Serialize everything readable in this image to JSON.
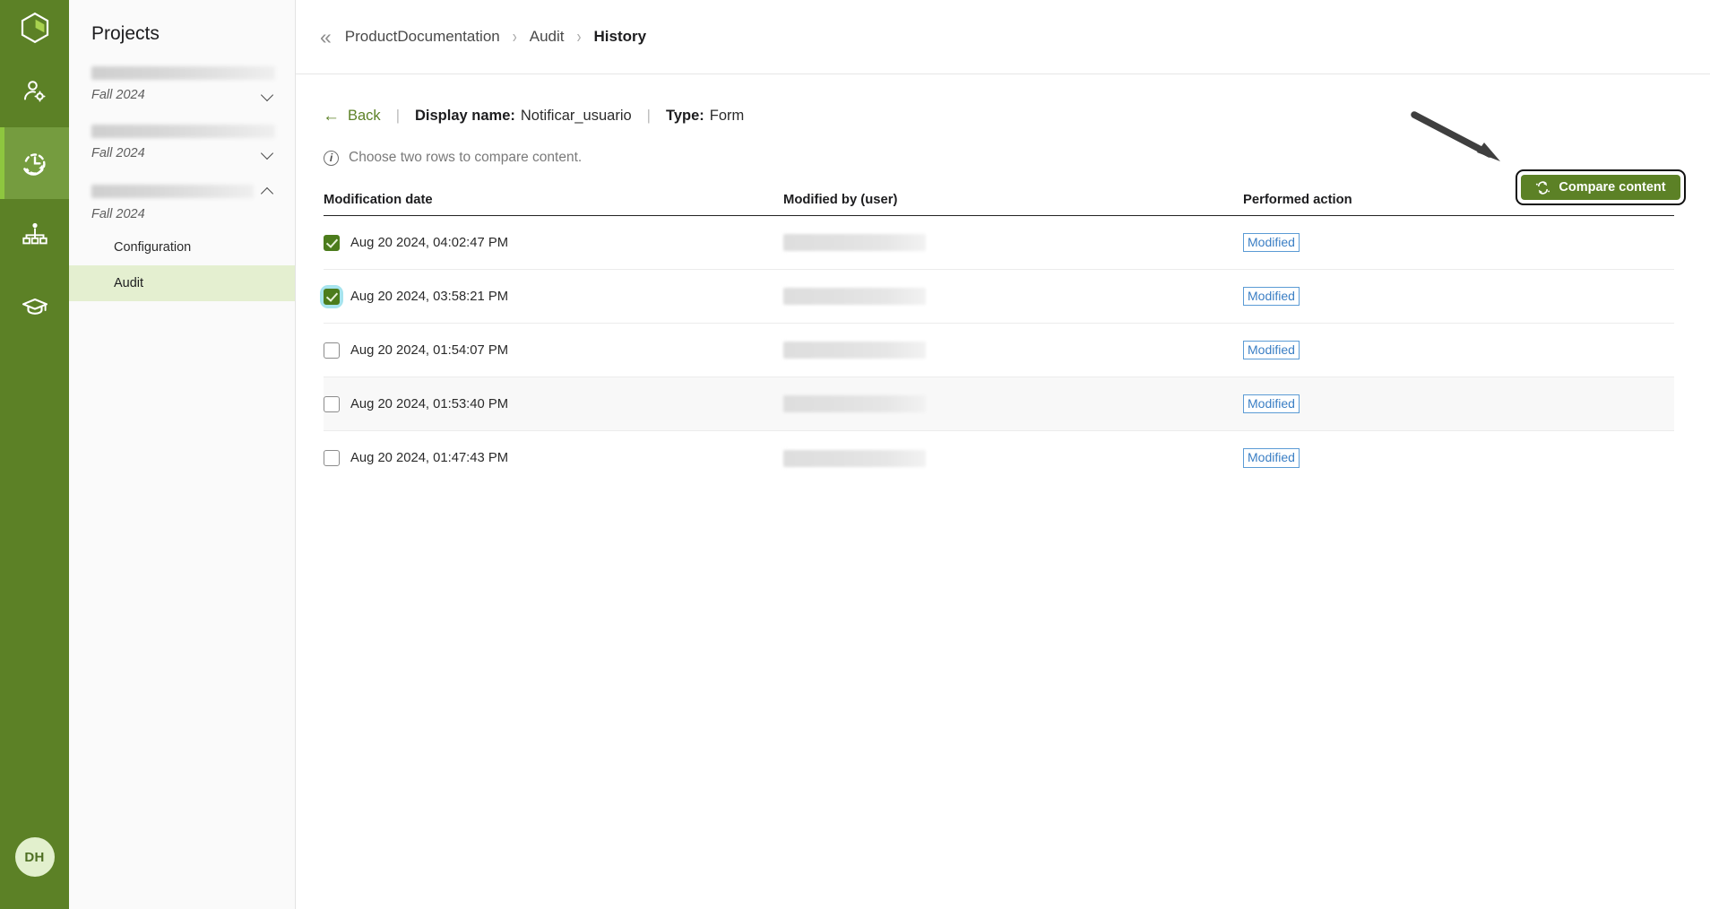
{
  "rail": {
    "logo_icon": "hexagon-logo-icon",
    "items": [
      {
        "name": "user-settings-icon",
        "active": false
      },
      {
        "name": "history-clock-icon",
        "active": true
      },
      {
        "name": "org-chart-icon",
        "active": false
      },
      {
        "name": "graduation-cap-icon",
        "active": false
      }
    ],
    "avatar_initials": "DH",
    "active_color": "#759c3f",
    "brand_color": "#5c8126"
  },
  "panel": {
    "title": "Projects",
    "groups": [
      {
        "season": "Fall 2024",
        "expanded": false
      },
      {
        "season": "Fall 2024",
        "expanded": false
      },
      {
        "season": "Fall 2024",
        "expanded": true
      }
    ],
    "sub_items": [
      {
        "label": "Configuration",
        "active": false
      },
      {
        "label": "Audit",
        "active": true
      }
    ],
    "active_bg": "#e4efd0"
  },
  "breadcrumb": {
    "collapse_icon": "«",
    "separator": "›",
    "items": [
      {
        "label": "ProductDocumentation",
        "current": false
      },
      {
        "label": "Audit",
        "current": false
      },
      {
        "label": "History",
        "current": true
      }
    ]
  },
  "subheader": {
    "back_label": "Back",
    "back_arrow": "←",
    "divider": "|",
    "display_name_label": "Display name:",
    "display_name_value": "Notificar_usuario",
    "type_label": "Type:",
    "type_value": "Form"
  },
  "hint": {
    "icon": "info-circle-icon",
    "icon_glyph": "i",
    "text": "Choose two rows to compare content."
  },
  "compare_button": {
    "label": "Compare content",
    "icon": "compare-sync-icon",
    "color": "#5c8126",
    "focused": true
  },
  "annotation": {
    "type": "arrow",
    "color": "#3f3f3f",
    "points_to": "compare-content-button"
  },
  "table": {
    "columns": [
      "Modification date",
      "Modified by (user)",
      "Performed action"
    ],
    "rows": [
      {
        "date": "Aug 20 2024, 04:02:47 PM",
        "user": "",
        "action": "Modified",
        "checked": true,
        "focused": false,
        "hovered": false
      },
      {
        "date": "Aug 20 2024, 03:58:21 PM",
        "user": "",
        "action": "Modified",
        "checked": true,
        "focused": true,
        "hovered": false
      },
      {
        "date": "Aug 20 2024, 01:54:07 PM",
        "user": "",
        "action": "Modified",
        "checked": false,
        "focused": false,
        "hovered": false
      },
      {
        "date": "Aug 20 2024, 01:53:40 PM",
        "user": "",
        "action": "Modified",
        "checked": false,
        "focused": false,
        "hovered": true
      },
      {
        "date": "Aug 20 2024, 01:47:43 PM",
        "user": "",
        "action": "Modified",
        "checked": false,
        "focused": false,
        "hovered": false
      }
    ]
  }
}
